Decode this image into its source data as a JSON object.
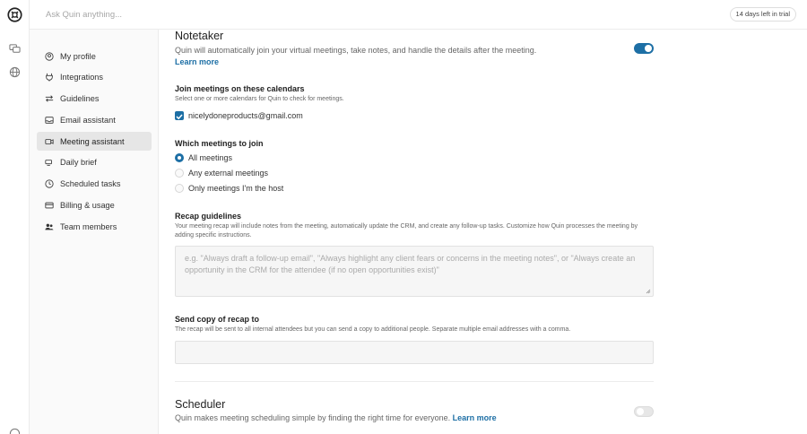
{
  "top": {
    "ask_placeholder": "Ask Quin anything...",
    "trial_badge": "14 days left in trial"
  },
  "sidebar": {
    "items": [
      {
        "label": "My profile",
        "icon": "user-circle-icon"
      },
      {
        "label": "Integrations",
        "icon": "plug-icon"
      },
      {
        "label": "Guidelines",
        "icon": "arrows-icon"
      },
      {
        "label": "Email assistant",
        "icon": "inbox-icon"
      },
      {
        "label": "Meeting assistant",
        "icon": "video-icon",
        "active": true
      },
      {
        "label": "Daily brief",
        "icon": "cup-icon"
      },
      {
        "label": "Scheduled tasks",
        "icon": "clock-icon"
      },
      {
        "label": "Billing & usage",
        "icon": "card-icon"
      },
      {
        "label": "Team members",
        "icon": "users-icon"
      }
    ]
  },
  "notetaker": {
    "title": "Notetaker",
    "desc": "Quin will automatically join your virtual meetings, take notes, and handle the details after the meeting.",
    "learn_more": "Learn more",
    "enabled": true
  },
  "calendars": {
    "title": "Join meetings on these calendars",
    "sub": "Select one or more calendars for Quin to check for meetings.",
    "items": [
      {
        "label": "nicelydoneproducts@gmail.com",
        "checked": true
      }
    ]
  },
  "which": {
    "title": "Which meetings to join",
    "options": [
      {
        "label": "All meetings",
        "selected": true
      },
      {
        "label": "Any external meetings",
        "selected": false
      },
      {
        "label": "Only meetings I'm the host",
        "selected": false
      }
    ]
  },
  "recap": {
    "title": "Recap guidelines",
    "sub": "Your meeting recap will include notes from the meeting, automatically update the CRM, and create any follow-up tasks. Customize how Quin processes the meeting by adding specific instructions.",
    "placeholder": "e.g. \"Always draft a follow-up email\", \"Always highlight any client fears or concerns in the meeting notes\", or \"Always create an opportunity in the CRM for the attendee (if no open opportunities exist)\""
  },
  "copy": {
    "title": "Send copy of recap to",
    "sub": "The recap will be sent to all internal attendees but you can send a copy to additional people. Separate multiple email addresses with a comma.",
    "value": ""
  },
  "scheduler": {
    "title": "Scheduler",
    "desc": "Quin makes meeting scheduling simple by finding the right time for everyone.",
    "learn_more": "Learn more",
    "enabled": false
  },
  "colors": {
    "accent": "#1d6fa5"
  }
}
